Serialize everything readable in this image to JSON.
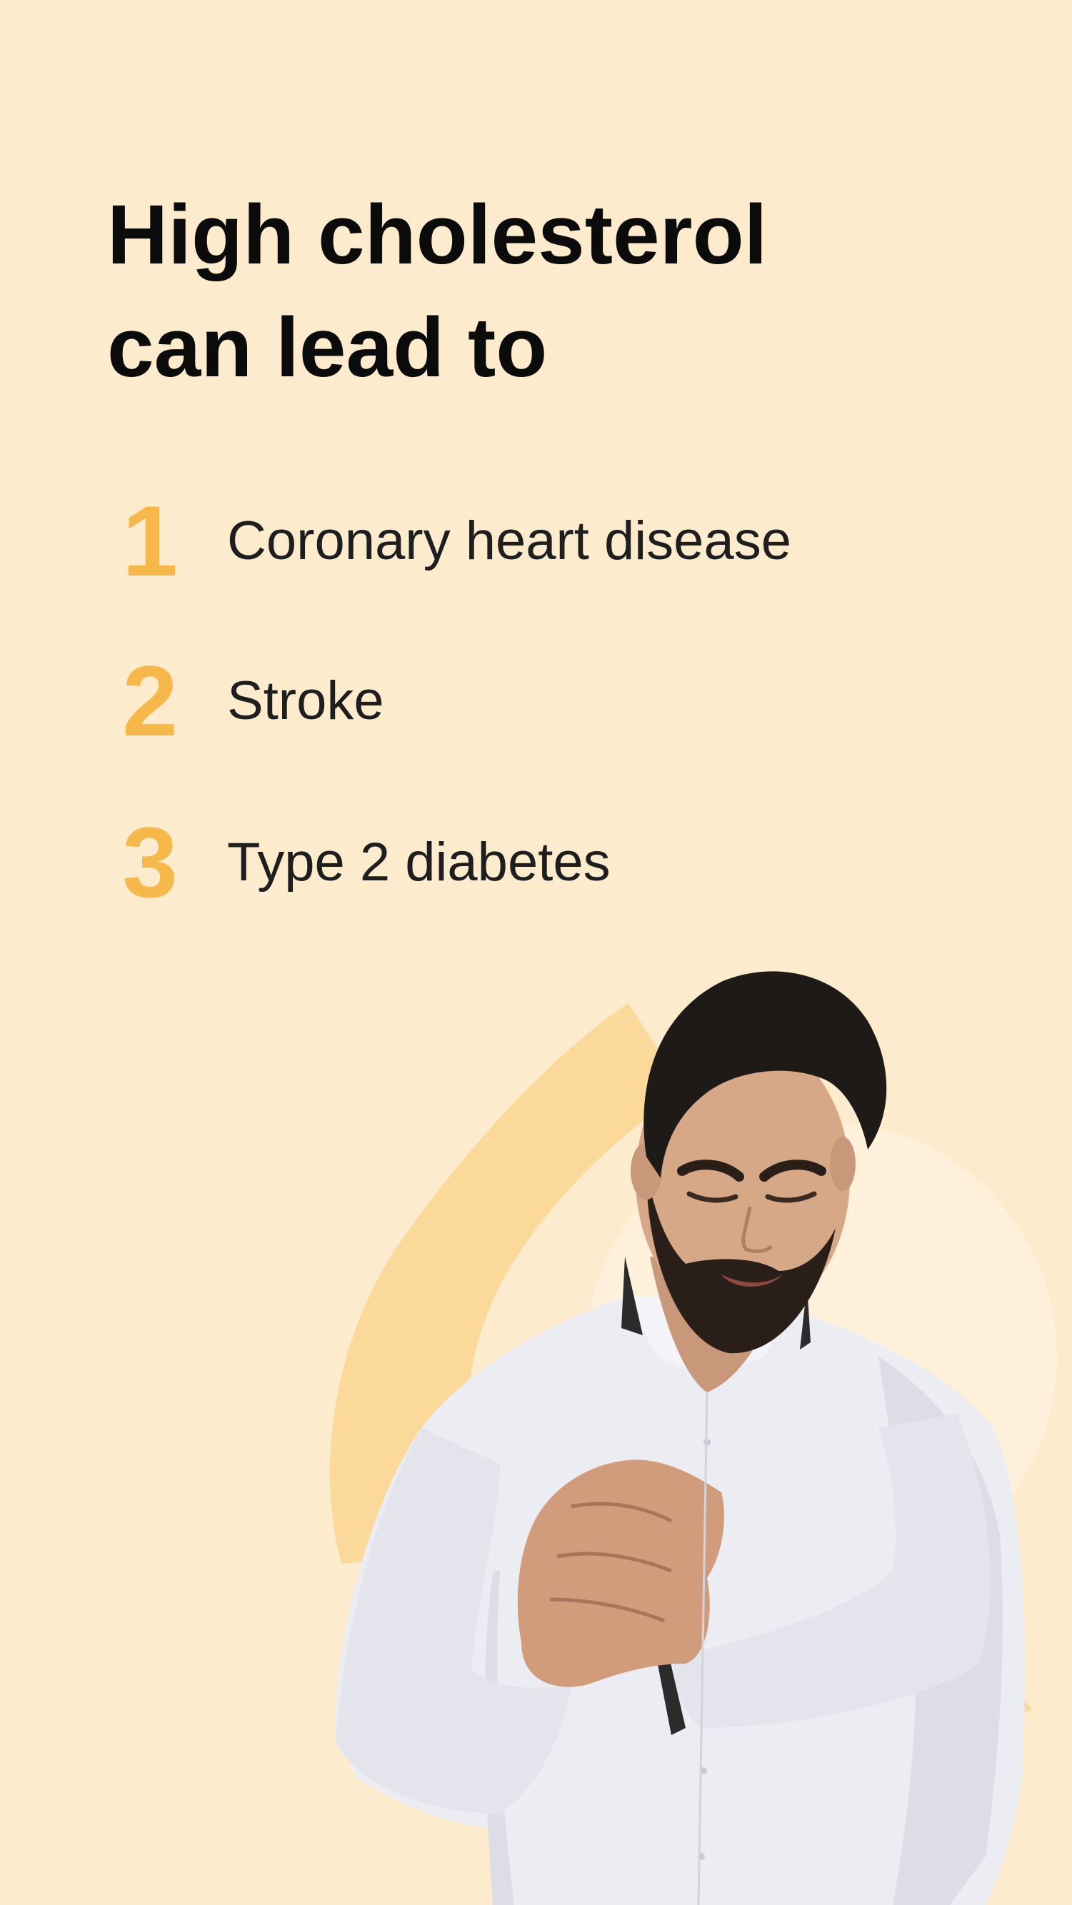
{
  "headline": {
    "line1": "High cholesterol",
    "line2": "can lead to"
  },
  "list": [
    {
      "number": "1",
      "label": "Coronary heart disease"
    },
    {
      "number": "2",
      "label": "Stroke"
    },
    {
      "number": "3",
      "label": "Type 2 diabetes"
    }
  ],
  "colors": {
    "background": "#FDEBCD",
    "accent": "#F7B84B",
    "arc": "#FBD99A",
    "circle": "#FEF0DB",
    "text": "#1E1E1E"
  }
}
